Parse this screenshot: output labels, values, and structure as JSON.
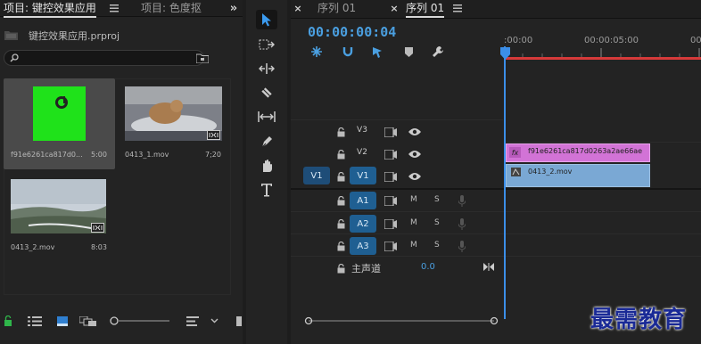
{
  "project_panel": {
    "tab_active": "项目: 键控效果应用",
    "tab_inactive": "项目: 色度抠",
    "project_file": "键控效果应用.prproj",
    "search_placeholder": "",
    "clips": [
      {
        "name": "f91e6261ca817d0...",
        "duration": "5:00"
      },
      {
        "name": "0413_1.mov",
        "duration": "7;20"
      },
      {
        "name": "0413_2.mov",
        "duration": "8:03"
      }
    ]
  },
  "timeline": {
    "tab_inactive": "序列 01",
    "tab_active": "序列 01",
    "timecode": "00:00:00:04",
    "ruler_ticks": [
      ":00:00",
      "00:00:05:00",
      "00:"
    ],
    "video_tracks": [
      {
        "label": "V3",
        "source": ""
      },
      {
        "label": "V2",
        "source": ""
      },
      {
        "label": "V1",
        "source": "V1"
      }
    ],
    "audio_tracks": [
      {
        "label": "A1",
        "m": "M",
        "s": "S"
      },
      {
        "label": "A2",
        "m": "M",
        "s": "S"
      },
      {
        "label": "A3",
        "m": "M",
        "s": "S"
      }
    ],
    "master": {
      "label": "主声道",
      "value": "0.0"
    },
    "clip_v2": "f91e6261ca817d0263a2ae66ae",
    "clip_v1": "0413_2.mov"
  },
  "watermark": "最需教育",
  "colors": {
    "accent": "#4a9fe0",
    "v2_clip": "#d273d6",
    "v1_clip": "#7aa8d4",
    "track_target": "#1f5f92"
  }
}
